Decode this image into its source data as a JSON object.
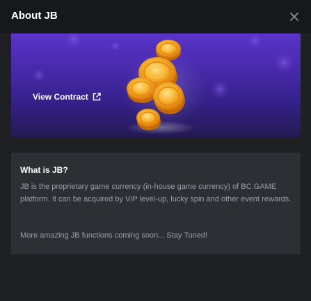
{
  "modal": {
    "title": "About JB",
    "close_icon": "close-icon"
  },
  "banner": {
    "link_label": "View Contract",
    "link_icon": "external-link-icon",
    "artwork": "gold-coins-stack"
  },
  "info": {
    "heading": "What is JB?",
    "description": "JB is the proprietary game currency (in-house game currency) of BC.GAME platform. It can be acquired by VIP level-up, lucky spin and other event rewards.",
    "note": "More amazing JB functions coming soon... Stay Tuned!"
  },
  "colors": {
    "background": "#1f2024",
    "header": "#17181b",
    "panel": "#2c2f33",
    "banner_top": "#5a34c8",
    "banner_bottom": "#241a52",
    "coin": "#f5a623",
    "body_text": "#9aa0a8"
  }
}
